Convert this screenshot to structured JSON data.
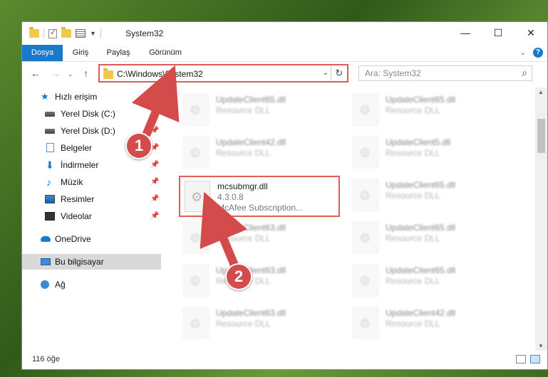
{
  "window": {
    "title": "System32",
    "controls": {
      "minimize": "—",
      "maximize": "☐",
      "close": "✕"
    }
  },
  "ribbon": {
    "tabs": [
      "Dosya",
      "Giriş",
      "Paylaş",
      "Görünüm"
    ],
    "help": "?"
  },
  "address": {
    "path": "C:\\Windows\\System32",
    "search_placeholder": "Ara: System32"
  },
  "nav": {
    "items": [
      {
        "label": "Hızlı erişim"
      },
      {
        "label": "Yerel Disk (C:)"
      },
      {
        "label": "Yerel Disk (D:)"
      },
      {
        "label": "Belgeler"
      },
      {
        "label": "İndirmeler"
      },
      {
        "label": "Müzik"
      },
      {
        "label": "Resimler"
      },
      {
        "label": "Videolar"
      },
      {
        "label": "OneDrive"
      },
      {
        "label": "Bu bilgisayar"
      },
      {
        "label": "Ağ"
      }
    ]
  },
  "files": {
    "left": [
      {
        "name": "UpdateClient65.dll",
        "l1": "Resource DLL",
        "l2": ""
      },
      {
        "name": "UpdateClient42.dll",
        "l1": "Resource DLL",
        "l2": ""
      },
      {
        "name": "mcsubmgr.dll",
        "l1": "4.3.0.8",
        "l2": "McAfee Subscription..."
      },
      {
        "name": "UpdateClient63.dll",
        "l1": "Resource DLL",
        "l2": ""
      },
      {
        "name": "UpdateClient63.dll",
        "l1": "Resource DLL",
        "l2": ""
      },
      {
        "name": "UpdateClient63.dll",
        "l1": "Resource DLL",
        "l2": ""
      }
    ],
    "right": [
      {
        "name": "UpdateClient65.dll",
        "l1": "Resource DLL",
        "l2": ""
      },
      {
        "name": "UpdateClient5.dll",
        "l1": "Resource DLL",
        "l2": ""
      },
      {
        "name": "UpdateClient65.dll",
        "l1": "Resource DLL",
        "l2": ""
      },
      {
        "name": "UpdateClient65.dll",
        "l1": "Resource DLL",
        "l2": ""
      },
      {
        "name": "UpdateClient65.dll",
        "l1": "Resource DLL",
        "l2": ""
      },
      {
        "name": "UpdateClient42.dll",
        "l1": "Resource DLL",
        "l2": ""
      }
    ]
  },
  "status": {
    "count": "116 öğe"
  },
  "annotations": {
    "badge1": "1",
    "badge2": "2",
    "accent": "#d44b4b"
  }
}
